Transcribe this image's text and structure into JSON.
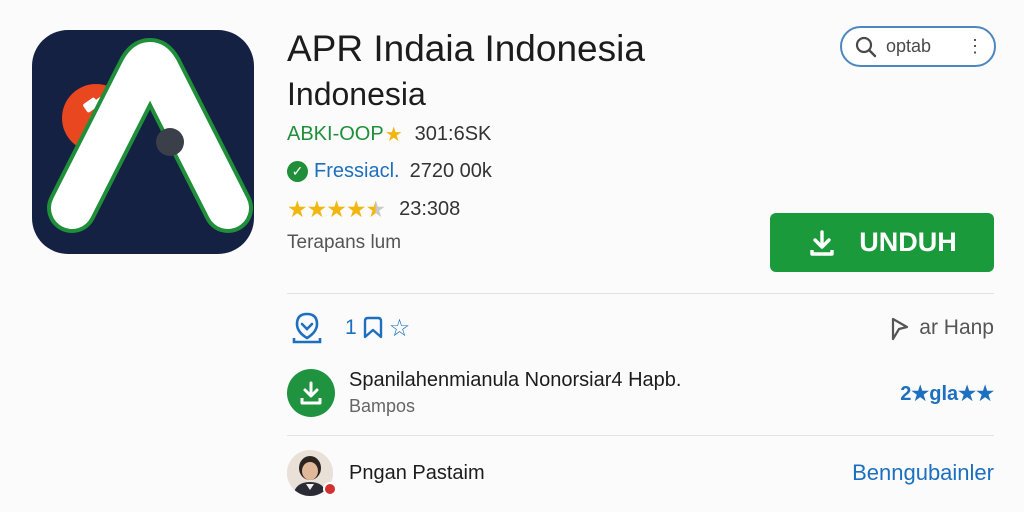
{
  "app": {
    "title": "APR Indaia Indonesia",
    "subtitle": "Indonesia",
    "developer": "ABKI-OOP",
    "developer_count": "301:6SK",
    "verified_label": "Fressiacl.",
    "verified_count": "2720 00k",
    "rating_stars": 4.5,
    "rating_count": "23:308",
    "installed_text": "Terapans lum",
    "icon_name": "app-logo-icon"
  },
  "search": {
    "text": "optab",
    "icon": "search-icon",
    "menu_icon": "more-vertical-icon"
  },
  "install_button": {
    "label": "UNDUH",
    "icon": "download-icon",
    "color": "#1a9a3a"
  },
  "actions": {
    "download_icon": "download-outline-icon",
    "wishlist_label": "1",
    "wishlist_icon": "bookmark-icon",
    "star_icon": "star-outline-icon",
    "share_label": "ar Hanp",
    "share_icon": "share-icon"
  },
  "recommendation": {
    "title": "Spanilahenmianula Nonorsiar4 Hapb.",
    "subtitle": "Bampos",
    "rating_text": "2★gla★★",
    "icon": "download-circle-icon"
  },
  "author": {
    "name": "Pngan Pastaim",
    "link": "Benngubainler",
    "avatar": "avatar"
  },
  "colors": {
    "green": "#1f8f3a",
    "blue": "#1d6fbf",
    "navy": "#142143",
    "star": "#f1b70f"
  }
}
